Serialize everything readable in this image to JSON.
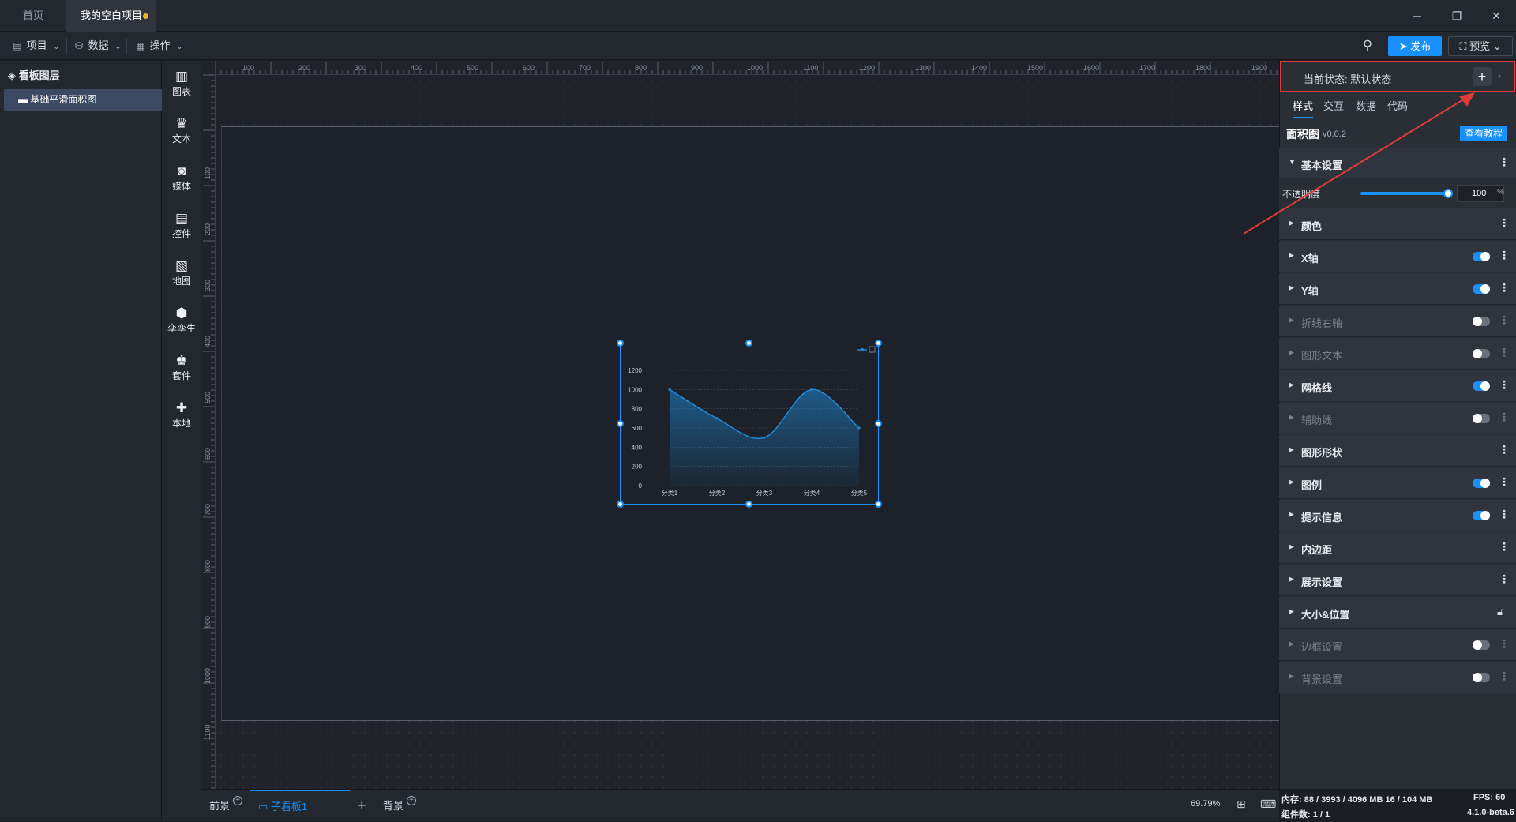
{
  "tabs": {
    "home": "首页",
    "project": "我的空白项目"
  },
  "window": {
    "minimize": "─",
    "restore": "❐",
    "close": "✕"
  },
  "menu": {
    "project": "项目",
    "data": "数据",
    "operate": "操作"
  },
  "toolbar": {
    "publish": "发布",
    "preview": "预览"
  },
  "layers": {
    "title": "看板图层",
    "items": [
      "基础平滑面积图"
    ]
  },
  "palette": [
    {
      "icon": "chart-icon",
      "glyph": "▥",
      "label": "图表"
    },
    {
      "icon": "text-icon",
      "glyph": "♛",
      "label": "文本"
    },
    {
      "icon": "media-icon",
      "glyph": "◙",
      "label": "媒体"
    },
    {
      "icon": "control-icon",
      "glyph": "▤",
      "label": "控件"
    },
    {
      "icon": "map-icon",
      "glyph": "▧",
      "label": "地图"
    },
    {
      "icon": "twin-icon",
      "glyph": "⬢",
      "label": "孪孪生"
    },
    {
      "icon": "kit-icon",
      "glyph": "♚",
      "label": "套件"
    },
    {
      "icon": "local-icon",
      "glyph": "✚",
      "label": "本地"
    }
  ],
  "ruler": {
    "h_labels": [
      "100",
      "200",
      "300",
      "400",
      "500",
      "600",
      "700",
      "800",
      "900",
      "1000",
      "1100",
      "1200",
      "1300",
      "1400",
      "1500",
      "1600",
      "1700",
      "1800",
      "1900"
    ],
    "v_labels": [
      "100",
      "200",
      "300",
      "400",
      "500",
      "600",
      "700",
      "800",
      "900",
      "1000",
      "1100"
    ]
  },
  "chart_data": {
    "type": "area",
    "categories": [
      "分类1",
      "分类2",
      "分类3",
      "分类4",
      "分类5"
    ],
    "values": [
      1000,
      700,
      500,
      1000,
      600
    ],
    "ylim": [
      0,
      1200
    ],
    "yticks": [
      "1200",
      "1000",
      "800",
      "600",
      "400",
      "200",
      "0"
    ],
    "smooth": true,
    "color": "#1f8ad8",
    "grid": true
  },
  "bottom": {
    "foreground": "前景",
    "subboard": "子看板1",
    "add": "+",
    "background": "背景",
    "zoom": "69.79%"
  },
  "rpanel": {
    "state_label": "当前状态:  默认状态",
    "tabs": [
      "样式",
      "交互",
      "数据",
      "代码"
    ],
    "component": "面积图",
    "version": "v0.0.2",
    "tutorial": "查看教程",
    "opacity_label": "不透明度",
    "opacity_value": "100",
    "opacity_unit": "%",
    "opacity_level": 1.0,
    "sections": [
      {
        "label": "基本设置",
        "open": true,
        "toggle": null,
        "dim": false
      },
      {
        "label": "颜色",
        "toggle": null,
        "dim": false
      },
      {
        "label": "X轴",
        "toggle": "on",
        "dim": false
      },
      {
        "label": "Y轴",
        "toggle": "on",
        "dim": false
      },
      {
        "label": "折线右轴",
        "toggle": "off",
        "dim": true
      },
      {
        "label": "图形文本",
        "toggle": "off",
        "dim": true
      },
      {
        "label": "网格线",
        "toggle": "on",
        "dim": false
      },
      {
        "label": "辅助线",
        "toggle": "off",
        "dim": true
      },
      {
        "label": "图形形状",
        "toggle": null,
        "dim": false
      },
      {
        "label": "图例",
        "toggle": "on",
        "dim": false
      },
      {
        "label": "提示信息",
        "toggle": "on",
        "dim": false
      },
      {
        "label": "内边距",
        "toggle": null,
        "dim": false
      },
      {
        "label": "展示设置",
        "toggle": null,
        "dim": false
      },
      {
        "label": "大小&位置",
        "toggle": "lock",
        "dim": false
      },
      {
        "label": "边框设置",
        "toggle": "off",
        "dim": true
      },
      {
        "label": "背景设置",
        "toggle": "off",
        "dim": true
      }
    ]
  },
  "status": {
    "memory": "内存:  88 / 3993 / 4096 MB  16 / 104 MB",
    "components": "组件数: 1 / 1",
    "fps": "FPS:  60",
    "version": "4.1.0-beta.6"
  },
  "colors": {
    "accent": "#1890ff",
    "highlight": "#e03b3b"
  }
}
